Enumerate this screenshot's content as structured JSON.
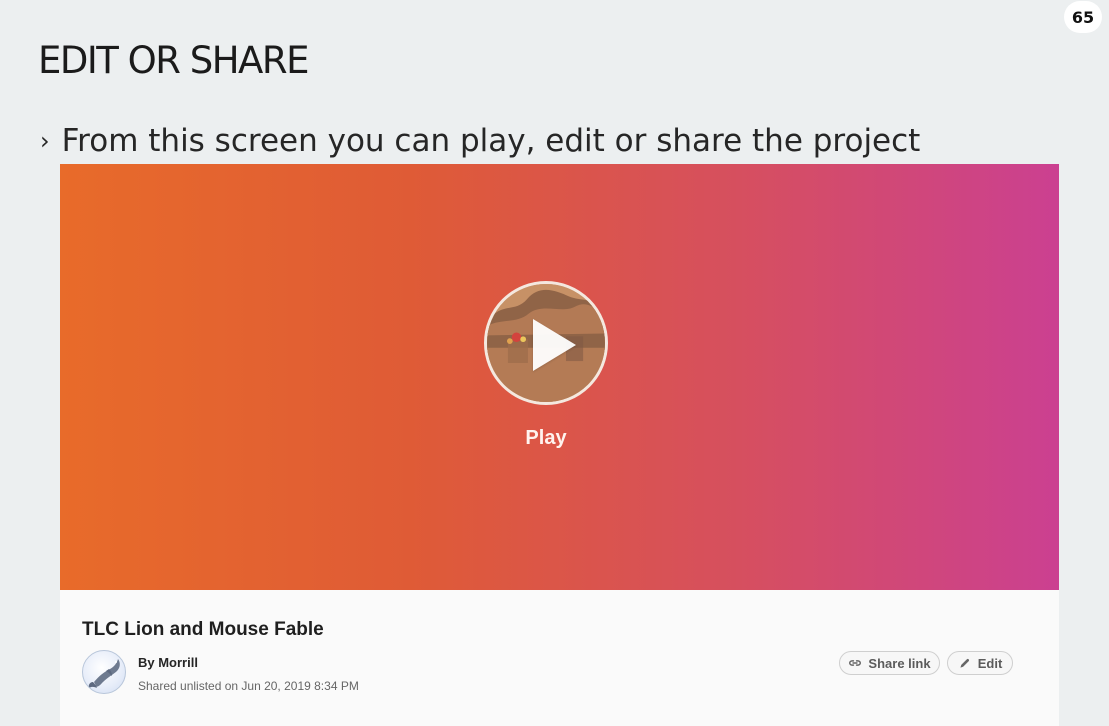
{
  "page_number": "65",
  "slide": {
    "title": "EDIT OR SHARE",
    "bullet": "From this screen you can play, edit or share the project"
  },
  "player": {
    "play_label": "Play",
    "icon": "play-icon"
  },
  "project": {
    "title": "TLC Lion and Mouse Fable",
    "author": "By Morrill",
    "shared_status": "Shared unlisted on Jun 20, 2019 8:34 PM"
  },
  "actions": {
    "share_link_label": "Share link",
    "share_link_icon": "link-icon",
    "edit_label": "Edit",
    "edit_icon": "pencil-icon"
  },
  "colors": {
    "hero_start": "#e86b2a",
    "hero_end": "#cb4091",
    "background": "#eceff0"
  }
}
